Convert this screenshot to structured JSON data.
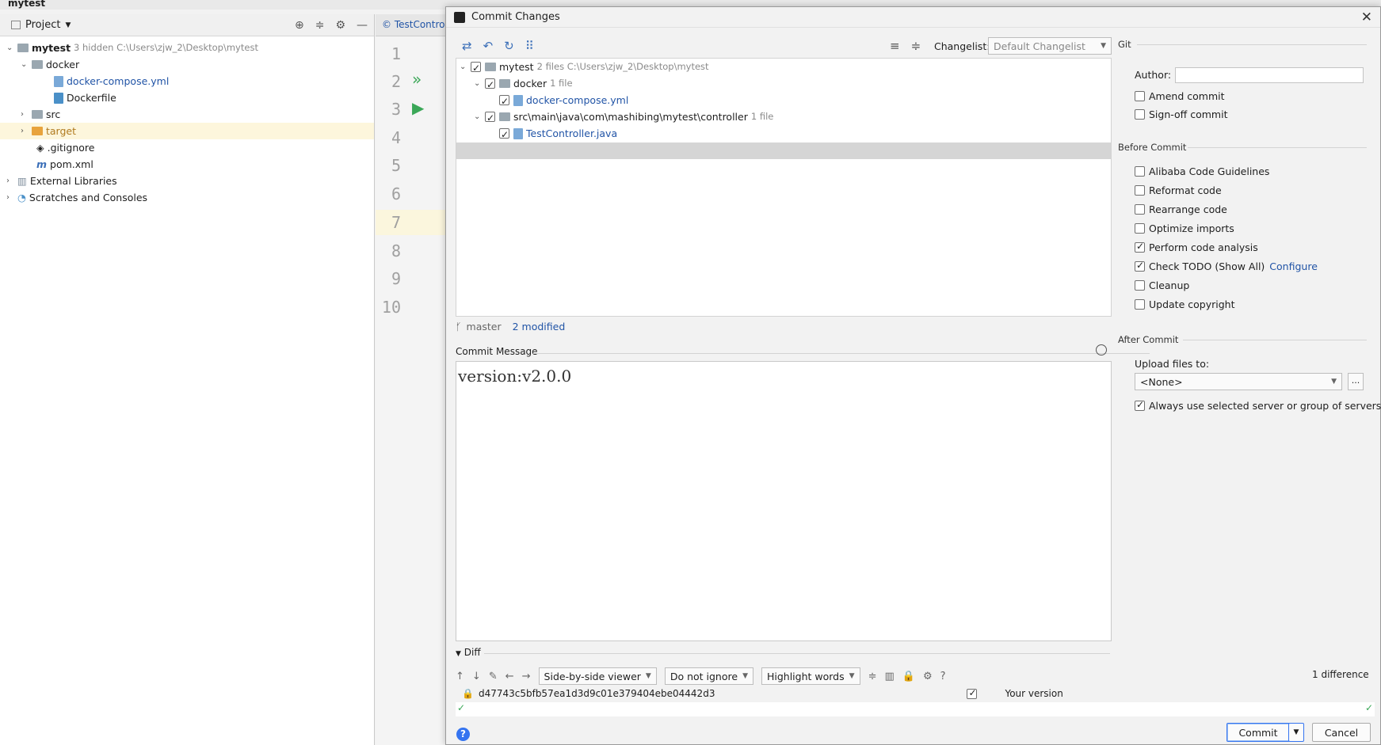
{
  "ide": {
    "title": "mytest",
    "editor_tab": "TestContro",
    "project_panel": {
      "header": "Project",
      "tree": [
        {
          "label": "mytest",
          "note": "3 hidden  C:\\Users\\zjw_2\\Desktop\\mytest"
        },
        {
          "label": "docker"
        },
        {
          "label": "docker-compose.yml"
        },
        {
          "label": "Dockerfile"
        },
        {
          "label": "src"
        },
        {
          "label": "target"
        },
        {
          "label": ".gitignore"
        },
        {
          "label": "pom.xml"
        },
        {
          "label": "External Libraries"
        },
        {
          "label": "Scratches and Consoles"
        }
      ]
    },
    "line_numbers": [
      "1",
      "2",
      "3",
      "4",
      "5",
      "6",
      "7",
      "8",
      "9",
      "10"
    ]
  },
  "dialog": {
    "title": "Commit Changes",
    "changelist_label": "Changelist:",
    "changelist_value": "Default Changelist",
    "changes": [
      {
        "label": "mytest",
        "note": "2 files  C:\\Users\\zjw_2\\Desktop\\mytest"
      },
      {
        "label": "docker",
        "note": "1 file"
      },
      {
        "label": "docker-compose.yml",
        "note": ""
      },
      {
        "label": "src\\main\\java\\com\\mashibing\\mytest\\controller",
        "note": "1 file"
      },
      {
        "label": "TestController.java",
        "note": ""
      }
    ],
    "branch": "master",
    "modified": "2 modified",
    "commit_message_label": "Commit Message",
    "commit_message": "version:v2.0.0",
    "diff": {
      "label": "Diff",
      "viewer": "Side-by-side viewer",
      "ignore": "Do not ignore",
      "highlight": "Highlight words",
      "difference_count": "1 difference",
      "hash": "d47743c5bfb57ea1d3d9c01e379404ebe04442d3",
      "your_version": "Your version"
    },
    "buttons": {
      "commit": "Commit",
      "cancel": "Cancel"
    },
    "git": {
      "section": "Git",
      "author_label": "Author:",
      "author_value": "",
      "amend": "Amend commit",
      "signoff": "Sign-off commit"
    },
    "before_commit": {
      "section": "Before Commit",
      "options": [
        {
          "label": "Alibaba Code Guidelines",
          "checked": false
        },
        {
          "label": "Reformat code",
          "checked": false
        },
        {
          "label": "Rearrange code",
          "checked": false
        },
        {
          "label": "Optimize imports",
          "checked": false
        },
        {
          "label": "Perform code analysis",
          "checked": true
        },
        {
          "label": "Check TODO (Show All)",
          "checked": true
        },
        {
          "label": "Cleanup",
          "checked": false
        },
        {
          "label": "Update copyright",
          "checked": false
        }
      ],
      "configure_link": "Configure"
    },
    "after_commit": {
      "section": "After Commit",
      "upload_label": "Upload files to:",
      "upload_value": "<None>",
      "more_label": "...",
      "always_use": "Always use selected server or group of servers"
    },
    "help": "?"
  }
}
